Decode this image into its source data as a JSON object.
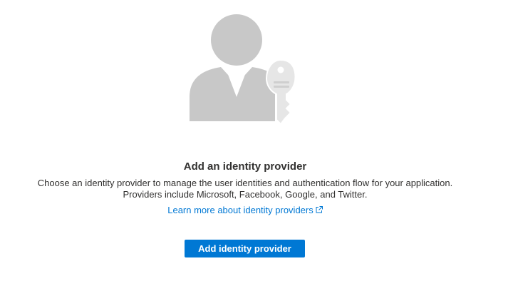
{
  "empty_state": {
    "illustration_icon": "user-with-key-icon",
    "title": "Add an identity provider",
    "description_line1": "Choose an identity provider to manage the user identities and authentication flow for your application.",
    "description_line2": "Providers include Microsoft, Facebook, Google, and Twitter.",
    "learn_more_link": "Learn more about identity providers",
    "learn_more_icon": "external-link-icon",
    "add_button_label": "Add identity provider"
  },
  "colors": {
    "accent": "#0078d4",
    "illustration_gray": "#c8c8c8",
    "text": "#323130",
    "background": "#ffffff"
  }
}
